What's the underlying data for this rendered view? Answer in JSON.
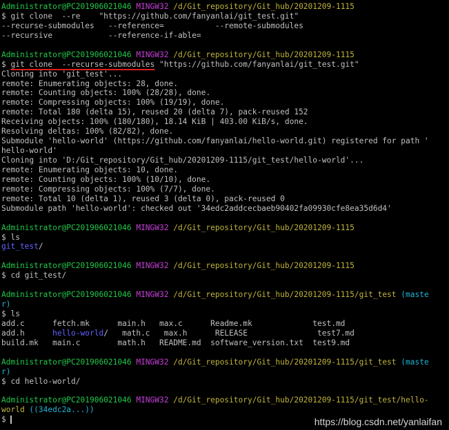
{
  "colors": {
    "user": "#22c94a",
    "shell": "#c63ed8",
    "path": "#c0b43c",
    "branch": "#21b3d1",
    "dir": "#6161ff",
    "text": "#c0c0c0",
    "underline": "#e02020"
  },
  "lines": [
    {
      "segments": [
        {
          "t": "Administrator@PC201906021046 ",
          "c": "g"
        },
        {
          "t": "MINGW32 ",
          "c": "m"
        },
        {
          "t": "/d/Git_repository/Git_hub/20201209-1115",
          "c": "y"
        }
      ]
    },
    {
      "segments": [
        {
          "t": "$ git clone  --re    \"https://github.com/fanyanlai/git_test.git\"",
          "c": "w"
        }
      ]
    },
    {
      "segments": [
        {
          "t": "--recurse-submodules   --reference=           --remote-submodules",
          "c": "w"
        }
      ]
    },
    {
      "segments": [
        {
          "t": "--recursive            --reference-if-able=",
          "c": "w"
        }
      ]
    },
    {
      "segments": []
    },
    {
      "segments": [
        {
          "t": "Administrator@PC201906021046 ",
          "c": "g"
        },
        {
          "t": "MINGW32 ",
          "c": "m"
        },
        {
          "t": "/d/Git_repository/Git_hub/20201209-1115",
          "c": "y"
        }
      ]
    },
    {
      "segments": [
        {
          "t": "$ ",
          "c": "w"
        },
        {
          "t": "git clone  --recurse-submodules",
          "c": "w",
          "u": true
        },
        {
          "t": " \"https://github.com/fanyanlai/git_test.git\"",
          "c": "w"
        }
      ]
    },
    {
      "segments": [
        {
          "t": "Cloning into 'git_test'...",
          "c": "w"
        }
      ]
    },
    {
      "segments": [
        {
          "t": "remote: Enumerating objects: 28, done.",
          "c": "w"
        }
      ]
    },
    {
      "segments": [
        {
          "t": "remote: Counting objects: 100% (28/28), done.",
          "c": "w"
        }
      ]
    },
    {
      "segments": [
        {
          "t": "remote: Compressing objects: 100% (19/19), done.",
          "c": "w"
        }
      ]
    },
    {
      "segments": [
        {
          "t": "remote: Total 180 (delta 15), reused 20 (delta 7), pack-reused 152",
          "c": "w"
        }
      ]
    },
    {
      "segments": [
        {
          "t": "Receiving objects: 100% (180/180), 18.14 KiB | 403.00 KiB/s, done.",
          "c": "w"
        }
      ]
    },
    {
      "segments": [
        {
          "t": "Resolving deltas: 100% (82/82), done.",
          "c": "w"
        }
      ]
    },
    {
      "segments": [
        {
          "t": "Submodule 'hello-world' (https://github.com/fanyanlai/hello-world.git) registered for path '",
          "c": "w"
        }
      ]
    },
    {
      "segments": [
        {
          "t": "hello-world'",
          "c": "w"
        }
      ]
    },
    {
      "segments": [
        {
          "t": "Cloning into 'D:/Git_repository/Git_hub/20201209-1115/git_test/hello-world'...",
          "c": "w"
        }
      ]
    },
    {
      "segments": [
        {
          "t": "remote: Enumerating objects: 10, done.",
          "c": "w"
        }
      ]
    },
    {
      "segments": [
        {
          "t": "remote: Counting objects: 100% (10/10), done.",
          "c": "w"
        }
      ]
    },
    {
      "segments": [
        {
          "t": "remote: Compressing objects: 100% (7/7), done.",
          "c": "w"
        }
      ]
    },
    {
      "segments": [
        {
          "t": "remote: Total 10 (delta 1), reused 3 (delta 0), pack-reused 0",
          "c": "w"
        }
      ]
    },
    {
      "segments": [
        {
          "t": "Submodule path 'hello-world': checked out '34edc2addcecbaeb90402fa09930cfe8ea35d6d4'",
          "c": "w"
        }
      ]
    },
    {
      "segments": []
    },
    {
      "segments": [
        {
          "t": "Administrator@PC201906021046 ",
          "c": "g"
        },
        {
          "t": "MINGW32 ",
          "c": "m"
        },
        {
          "t": "/d/Git_repository/Git_hub/20201209-1115",
          "c": "y"
        }
      ]
    },
    {
      "segments": [
        {
          "t": "$ ls",
          "c": "w"
        }
      ]
    },
    {
      "segments": [
        {
          "t": "git_test",
          "c": "b"
        },
        {
          "t": "/",
          "c": "w"
        }
      ]
    },
    {
      "segments": []
    },
    {
      "segments": [
        {
          "t": "Administrator@PC201906021046 ",
          "c": "g"
        },
        {
          "t": "MINGW32 ",
          "c": "m"
        },
        {
          "t": "/d/Git_repository/Git_hub/20201209-1115",
          "c": "y"
        }
      ]
    },
    {
      "segments": [
        {
          "t": "$ cd git_test/",
          "c": "w"
        }
      ]
    },
    {
      "segments": []
    },
    {
      "segments": [
        {
          "t": "Administrator@PC201906021046 ",
          "c": "g"
        },
        {
          "t": "MINGW32 ",
          "c": "m"
        },
        {
          "t": "/d/Git_repository/Git_hub/20201209-1115/git_test ",
          "c": "y"
        },
        {
          "t": "(maste",
          "c": "c"
        }
      ]
    },
    {
      "segments": [
        {
          "t": "r)",
          "c": "c"
        }
      ]
    },
    {
      "segments": [
        {
          "t": "$ ls",
          "c": "w"
        }
      ]
    },
    {
      "segments": [
        {
          "t": "add.c      fetch.mk      main.h   max.c      Readme.mk             test.md",
          "c": "w"
        }
      ]
    },
    {
      "segments": [
        {
          "t": "add.h      ",
          "c": "w"
        },
        {
          "t": "hello-world",
          "c": "b"
        },
        {
          "t": "/   math.c   max.h      RELEASE               test7.md",
          "c": "w"
        }
      ]
    },
    {
      "segments": [
        {
          "t": "build.mk   main.c        math.h   README.md  software_version.txt  test9.md",
          "c": "w"
        }
      ]
    },
    {
      "segments": []
    },
    {
      "segments": [
        {
          "t": "Administrator@PC201906021046 ",
          "c": "g"
        },
        {
          "t": "MINGW32 ",
          "c": "m"
        },
        {
          "t": "/d/Git_repository/Git_hub/20201209-1115/git_test ",
          "c": "y"
        },
        {
          "t": "(maste",
          "c": "c"
        }
      ]
    },
    {
      "segments": [
        {
          "t": "r)",
          "c": "c"
        }
      ]
    },
    {
      "segments": [
        {
          "t": "$ cd hello-world/",
          "c": "w"
        }
      ]
    },
    {
      "segments": []
    },
    {
      "segments": [
        {
          "t": "Administrator@PC201906021046 ",
          "c": "g"
        },
        {
          "t": "MINGW32 ",
          "c": "m"
        },
        {
          "t": "/d/Git_repository/Git_hub/20201209-1115/git_test/hello-",
          "c": "y"
        }
      ]
    },
    {
      "segments": [
        {
          "t": "world ",
          "c": "y"
        },
        {
          "t": "((34edc2a...))",
          "c": "c"
        }
      ]
    },
    {
      "segments": [
        {
          "t": "$ ",
          "c": "w"
        }
      ],
      "cursor": true
    }
  ],
  "watermark": "https://blog.csdn.net/yanlaifan"
}
